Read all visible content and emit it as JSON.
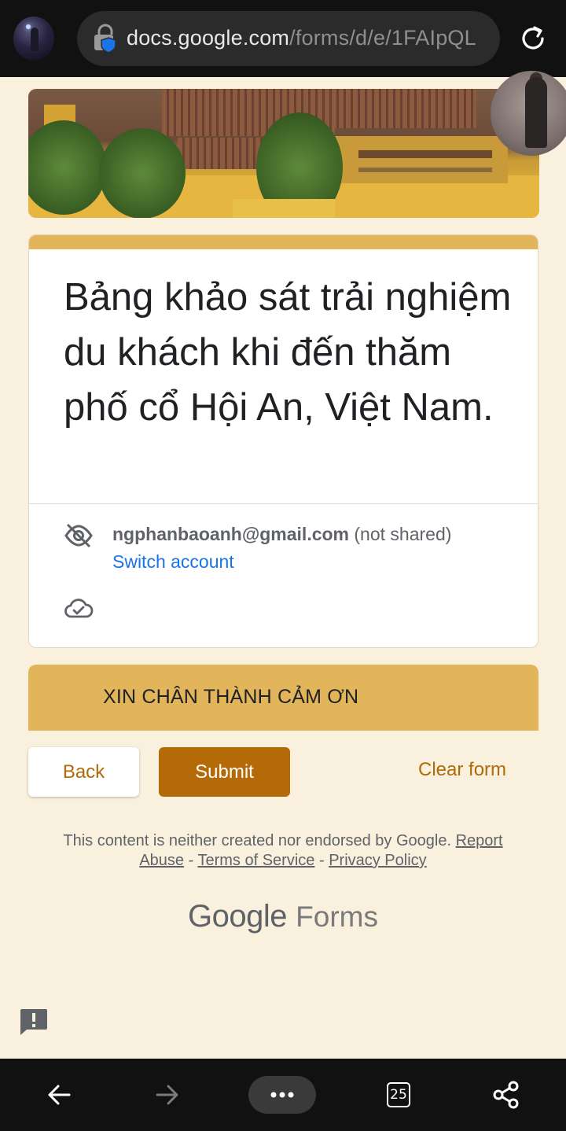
{
  "browser": {
    "url_host": "docs.google.com",
    "url_path": "/forms/d/e/1FAIpQL",
    "tab_count": "25"
  },
  "form": {
    "title": "Bảng khảo sát trải nghiệm du khách khi đến thăm phố cổ Hội An, Việt Nam.",
    "email": "ngphanbaoanh@gmail.com",
    "not_shared": "(not shared)",
    "switch_account": "Switch account",
    "section_title": "XIN CHÂN THÀNH CẢM ƠN"
  },
  "buttons": {
    "back": "Back",
    "submit": "Submit",
    "clear": "Clear form"
  },
  "footer": {
    "disclaimer": "This content is neither created nor endorsed by Google.",
    "report_abuse": "Report Abuse",
    "sep": " - ",
    "terms": "Terms of Service",
    "privacy": "Privacy Policy",
    "logo_google": "Google",
    "logo_forms": "Forms"
  },
  "colors": {
    "accent": "#e2b55a",
    "submit": "#b36a07",
    "link": "#1a73e8",
    "background": "#faf0de"
  },
  "icons": [
    "lock-icon",
    "refresh-icon",
    "visibility-off-icon",
    "cloud-done-icon",
    "report-icon",
    "back-arrow-icon",
    "forward-arrow-icon",
    "more-icon",
    "tabs-icon",
    "share-icon"
  ]
}
